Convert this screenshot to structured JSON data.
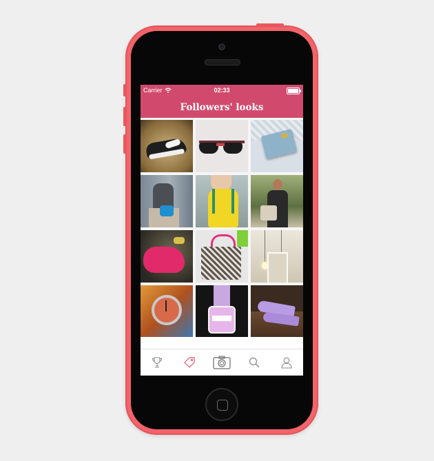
{
  "status_bar": {
    "carrier": "Carrier",
    "time": "02:33",
    "wifi_icon": "wifi-icon",
    "battery_level": 1.0
  },
  "nav": {
    "title": "Followers' looks"
  },
  "colors": {
    "brand": "#d14a6d",
    "phone_body": "#f2636a",
    "tab_active": "#e0576f",
    "tab_inactive": "#8a8a8a"
  },
  "photos": [
    {
      "subject": "sneakers-photo"
    },
    {
      "subject": "sunglasses-photo"
    },
    {
      "subject": "wallet-photo"
    },
    {
      "subject": "blue-bag-photo"
    },
    {
      "subject": "yellow-backpack-photo"
    },
    {
      "subject": "man-with-bag-photo"
    },
    {
      "subject": "pink-bag-photo"
    },
    {
      "subject": "tote-bag-photo"
    },
    {
      "subject": "light-bulbs-photo"
    },
    {
      "subject": "watch-photo"
    },
    {
      "subject": "nail-polish-photo"
    },
    {
      "subject": "purple-heels-photo"
    },
    {
      "subject": "photo-13"
    },
    {
      "subject": "photo-14"
    },
    {
      "subject": "photo-15"
    }
  ],
  "tabs": [
    {
      "icon": "trophy-icon",
      "active": false
    },
    {
      "icon": "tag-icon",
      "active": true
    },
    {
      "icon": "camera-icon",
      "active": false
    },
    {
      "icon": "search-icon",
      "active": false
    },
    {
      "icon": "profile-icon",
      "active": false
    }
  ]
}
